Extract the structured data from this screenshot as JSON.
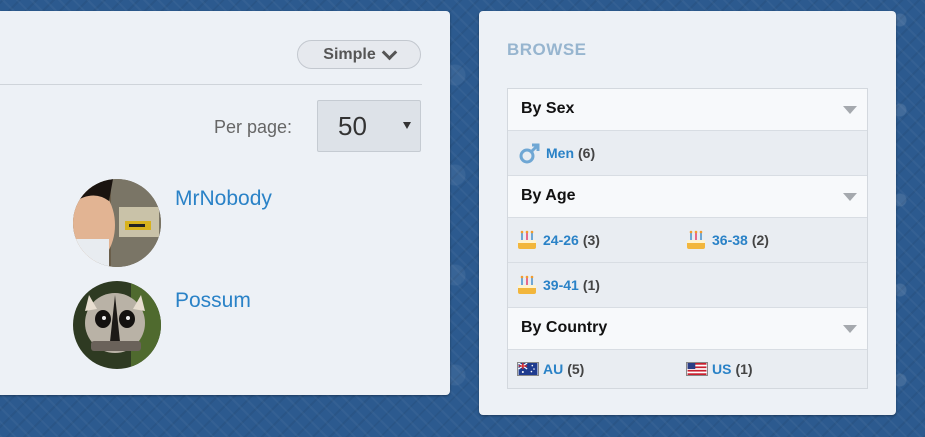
{
  "left_panel": {
    "mode_button": {
      "label": "Simple",
      "icon": "chevron-down-icon"
    },
    "per_page": {
      "label": "Per page:",
      "value": "50"
    },
    "members": [
      {
        "name": "MrNobody"
      },
      {
        "name": "Possum"
      }
    ]
  },
  "browse": {
    "title": "BROWSE",
    "sections": {
      "sex": {
        "title": "By Sex",
        "items": [
          {
            "label": "Men",
            "count": "(6)",
            "icon": "male-icon"
          }
        ]
      },
      "age": {
        "title": "By Age",
        "items": [
          {
            "label": "24-26",
            "count": "(3)",
            "icon": "birthday-cake-icon"
          },
          {
            "label": "36-38",
            "count": "(2)",
            "icon": "birthday-cake-icon"
          },
          {
            "label": "39-41",
            "count": "(1)",
            "icon": "birthday-cake-icon"
          }
        ]
      },
      "country": {
        "title": "By Country",
        "items": [
          {
            "label": "AU",
            "count": "(5)",
            "icon": "australia-flag-icon"
          },
          {
            "label": "US",
            "count": "(1)",
            "icon": "us-flag-icon"
          }
        ]
      }
    }
  },
  "colors": {
    "link": "#2a82c7",
    "panel_bg": "#edf1f6",
    "browse_title": "#97b5cf",
    "page_bg": "#2c5a8f"
  }
}
